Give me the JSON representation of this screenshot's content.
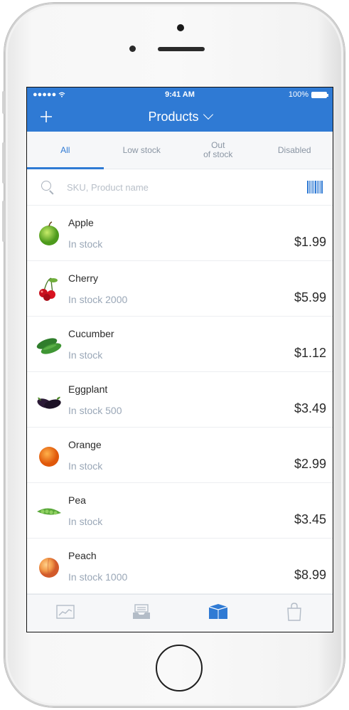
{
  "status_bar": {
    "signal": "●●●●● ",
    "wifi": "wifi-icon",
    "time": "9:41 AM",
    "battery": "100%"
  },
  "nav": {
    "title": "Products",
    "add_icon": "plus-icon",
    "dropdown_icon": "chevron-down-icon"
  },
  "tabs": [
    {
      "label": "All",
      "active": true
    },
    {
      "label": "Low stock",
      "active": false
    },
    {
      "label": "Out\nof stock",
      "active": false
    },
    {
      "label": "Disabled",
      "active": false
    }
  ],
  "search": {
    "placeholder": "SKU, Product name",
    "value": "",
    "scan_icon": "barcode-icon"
  },
  "products": [
    {
      "name": "Apple",
      "stock": "In stock",
      "price": "$1.99",
      "image": "apple"
    },
    {
      "name": "Cherry",
      "stock": "In stock 2000",
      "price": "$5.99",
      "image": "cherry"
    },
    {
      "name": "Cucumber",
      "stock": "In stock",
      "price": "$1.12",
      "image": "cucumber"
    },
    {
      "name": "Eggplant",
      "stock": "In stock 500",
      "price": "$3.49",
      "image": "eggplant"
    },
    {
      "name": "Orange",
      "stock": "In stock",
      "price": "$2.99",
      "image": "orange"
    },
    {
      "name": "Pea",
      "stock": "In stock",
      "price": "$3.45",
      "image": "pea"
    },
    {
      "name": "Peach",
      "stock": "In stock 1000",
      "price": "$8.99",
      "image": "peach"
    }
  ],
  "tab_bar": [
    {
      "icon": "chart-icon",
      "active": false
    },
    {
      "icon": "orders-tray-icon",
      "active": false
    },
    {
      "icon": "products-box-icon",
      "active": true
    },
    {
      "icon": "shopping-bag-icon",
      "active": false
    }
  ],
  "colors": {
    "accent": "#2f7ad4",
    "muted_text": "#9aa7b7",
    "tab_background": "#f6f7f9"
  }
}
